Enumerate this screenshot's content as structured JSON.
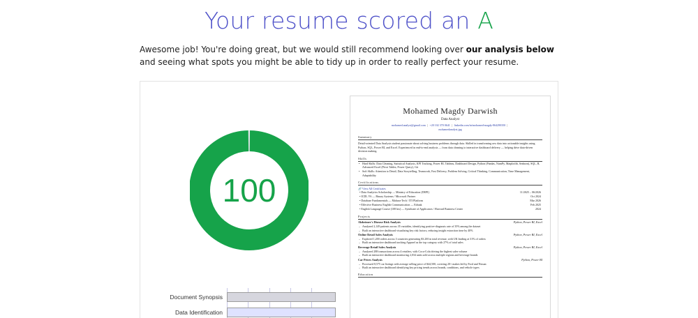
{
  "header": {
    "headline_prefix": "Your resume scored an ",
    "grade": "A"
  },
  "intro": {
    "text_1": "Awesome job! You're doing great, but we would still recommend looking over ",
    "bold": "our analysis below",
    "text_2": " and seeing what spots you might be able to tidy up in order to really perfect your resume."
  },
  "score": {
    "value": "100",
    "fraction": 1.0,
    "color": "#16a34a"
  },
  "analysis_bars": [
    {
      "label": "Document Synopsis",
      "fraction": 1.0
    },
    {
      "label": "Data Identification",
      "fraction": 1.0
    }
  ],
  "resume": {
    "name": "Mohamed Magdy Darwish",
    "title": "Data Analyst",
    "contacts": [
      "mohamed.analyst@gmail.com",
      "+20 102 370 0641",
      "linkedin.com/in/mohamed-magdy-864290350",
      "mohamedanalyst.jpg"
    ],
    "summary_heading": "Summary",
    "summary": "Detail-oriented Data Analysis student passionate about solving business problems through data. Skilled in transforming raw data into actionable insights using Python, SQL, Power BI, and Excel. Experienced in end-to-end analysis — from data cleaning to interactive dashboard delivery — helping drive data-driven decision making.",
    "skills_heading": "Skills",
    "skills": [
      "Hard Skills: Data Cleaning, Statistical Analysis, KPI Tracking, Power BI, Tableau, Dashboard Design, Python (Pandas, NumPy, Matplotlib, Seaborn), SQL, R, Advanced Excel (Pivot Tables, Power Query), Git",
      "Soft Skills: Attention to Detail, Data Storytelling, Teamwork, Fast Delivery, Problem Solving, Critical Thinking, Communication, Time Management, Adaptability"
    ],
    "cert_heading": "Certifications",
    "cert_link": "View All Certificates",
    "certs": [
      {
        "name": "Data Analytics Scholarship — Ministry of Education (DEPI)",
        "date": "11/2025 – 06/2026"
      },
      {
        "name": "ICDL V6 — Binary Systems / Microsoft Partner",
        "date": "Oct 2024"
      },
      {
        "name": "Database Fundamentals — Mahara-Tech / ITI Platform",
        "date": "Mar 2026"
      },
      {
        "name": "Effective Business English Communication — Edraak",
        "date": "Feb 2025"
      },
      {
        "name": "English Language Course (108 hrs) — Syndicate of Applicators / Harvard Business Center",
        "date": "2024"
      }
    ],
    "projects_heading": "Projects",
    "projects": [
      {
        "title": "Alzheimer's Disease Risk Analysis",
        "tools": "Python, Power BI, Excel",
        "bullets": [
          "Analyzed 2,149 patients across 35 variables, identifying positive-diagnosis rate of 35% among the dataset",
          "Built an interactive dashboard visualizing key risk factors, reducing insight extraction time by 40%"
        ]
      },
      {
        "title": "Online Retail Sales Analysis",
        "tools": "Python, Power BI, Excel",
        "bullets": [
          "Explored 1,200 orders across 3 countries generating $3.2M in total revenue, with UK leading at 31% of orders",
          "Built an interactive dashboard tracking Apparel as the top category with 27% of total sales"
        ]
      },
      {
        "title": "Beverage Retail Sales Analysis",
        "tools": "Python, Power BI, Excel",
        "bullets": [
          "Analyzed 288 transactions across 4 retailers, with Coca-Cola driving the highest sales volume",
          "Built an interactive dashboard monitoring 2,034 units sold across multiple regions and beverage brands"
        ]
      },
      {
        "title": "Car Prices Analysis",
        "tools": "Python, Power BI",
        "bullets": [
          "Processed 8,575 car listings with average selling price of $44,500, covering 20+ makes led by Ford and Nissan",
          "Built an interactive dashboard identifying key pricing trends across brands, conditions, and vehicle types"
        ]
      }
    ],
    "education_heading": "Education"
  }
}
